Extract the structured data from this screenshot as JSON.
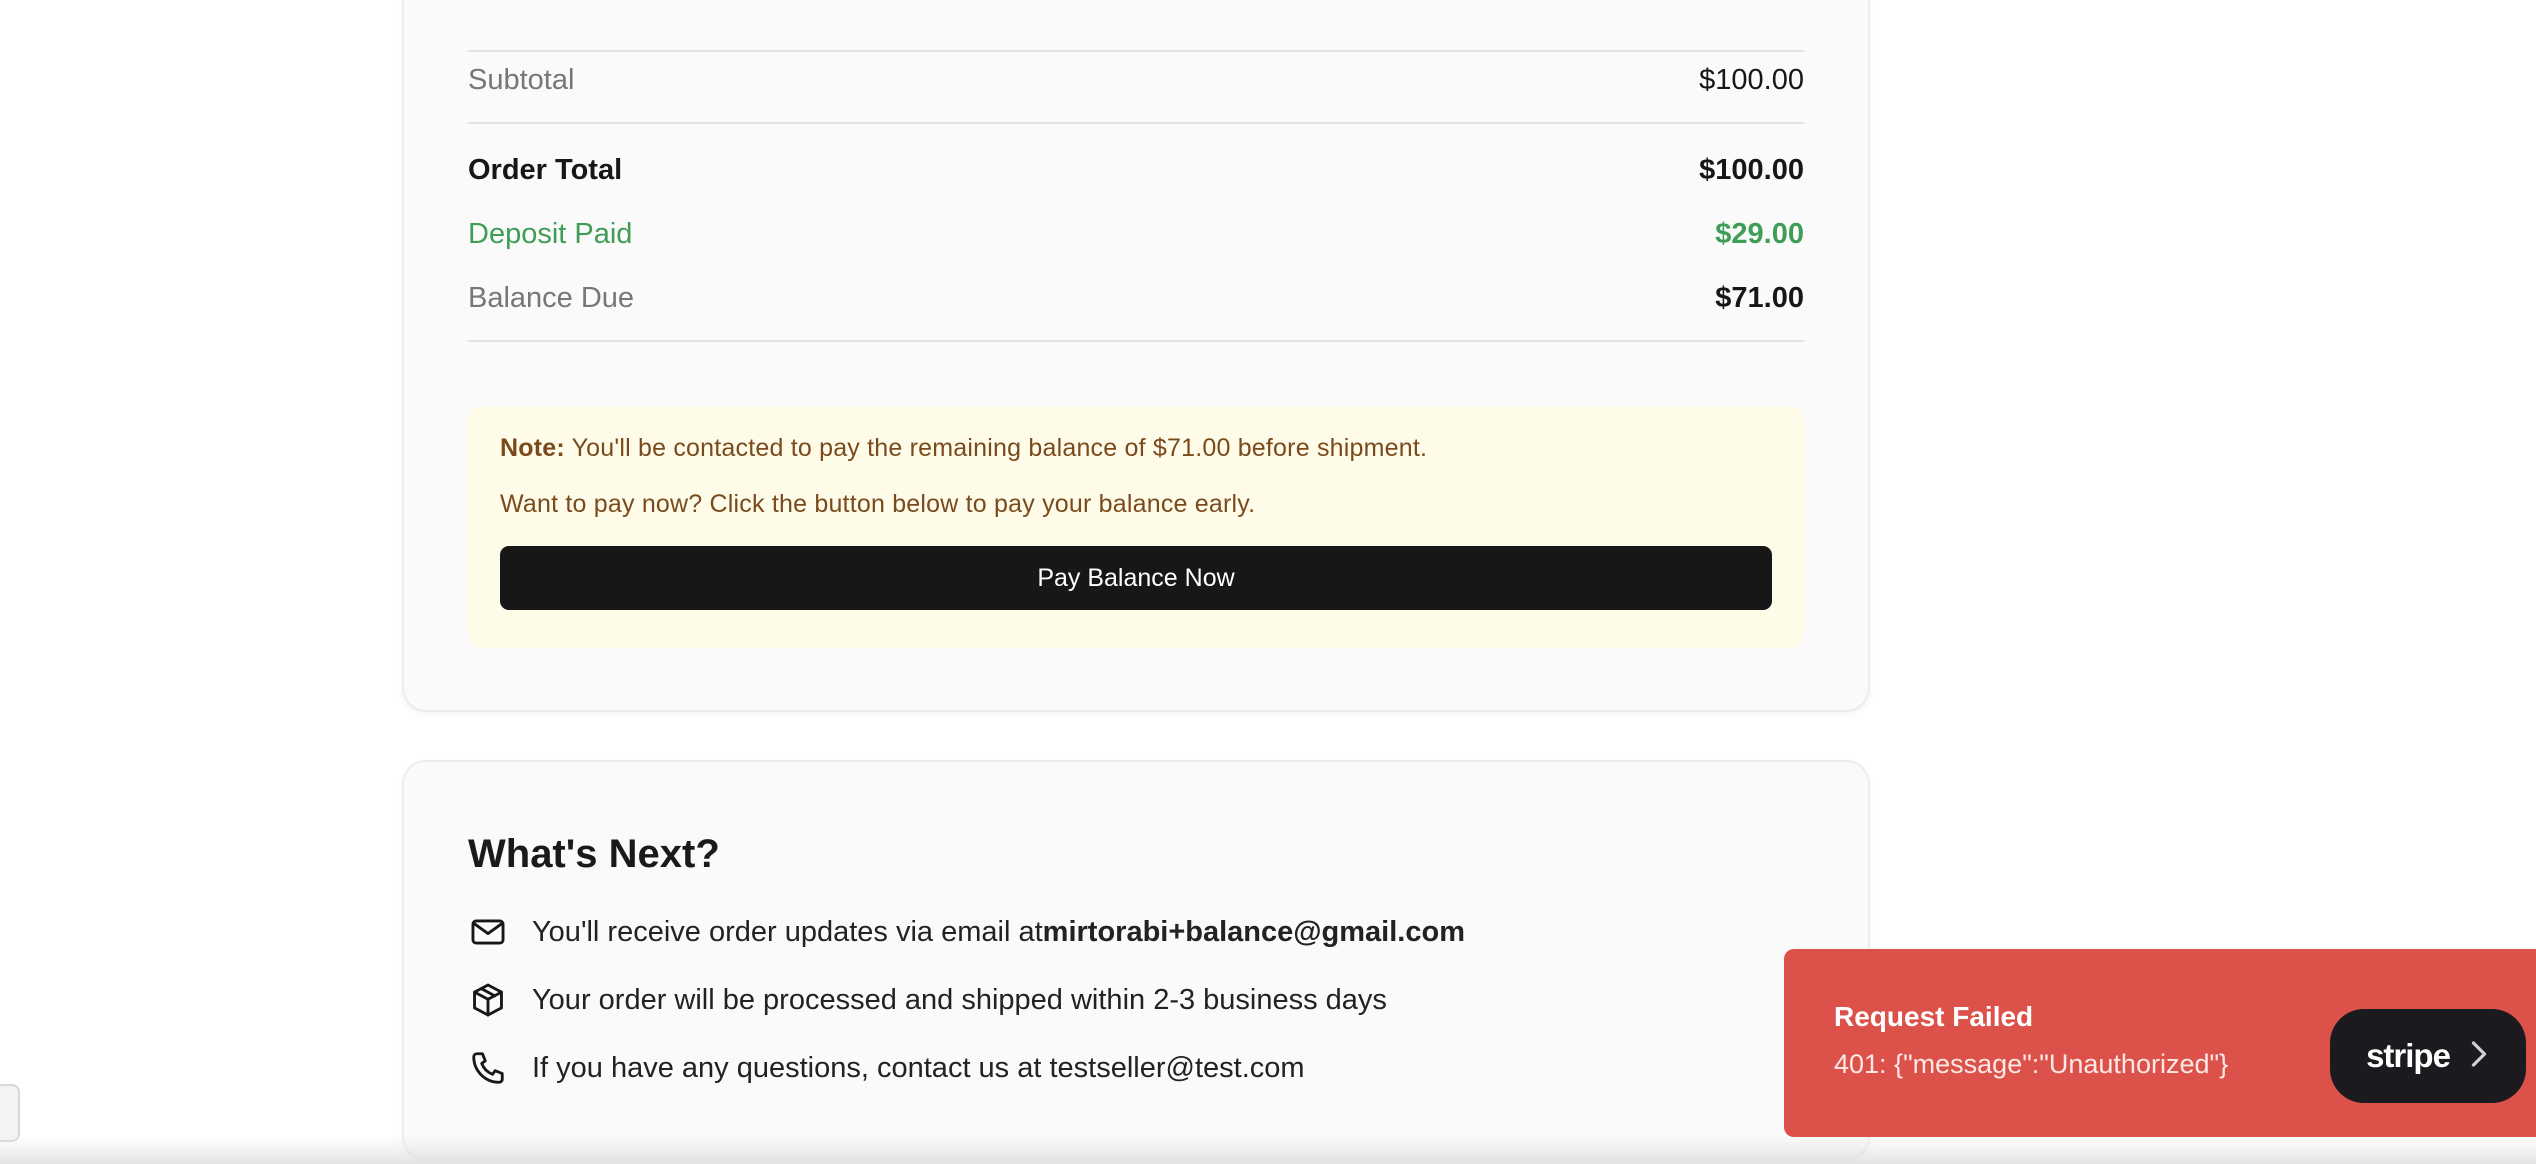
{
  "summary": {
    "subtotal_label": "Subtotal",
    "subtotal_value": "$100.00",
    "order_total_label": "Order Total",
    "order_total_value": "$100.00",
    "deposit_label": "Deposit Paid",
    "deposit_value": "$29.00",
    "balance_label": "Balance Due",
    "balance_value": "$71.00"
  },
  "note": {
    "prefix": "Note:",
    "line1": " You'll be contacted to pay the remaining balance of $71.00 before shipment.",
    "line2": "Want to pay now? Click the button below to pay your balance early.",
    "button_label": "Pay Balance Now"
  },
  "next": {
    "title": "What's Next?",
    "email_text": "You'll receive order updates via email at ",
    "email_address": "mirtorabi+balance@gmail.com",
    "shipping_text": "Your order will be processed and shipped within 2-3 business days",
    "contact_text": "If you have any questions, contact us at testseller@test.com"
  },
  "toast": {
    "title": "Request Failed",
    "message": "401: {\"message\":\"Unauthorized\"}",
    "brand": "stripe"
  },
  "colors": {
    "accent_green": "#3f9d57",
    "toast_red": "#dc524a",
    "note_bg": "#fefce9",
    "note_text": "#7a4a1c"
  },
  "icons": [
    "mail-icon",
    "package-icon",
    "phone-icon",
    "chevron-right-icon"
  ]
}
